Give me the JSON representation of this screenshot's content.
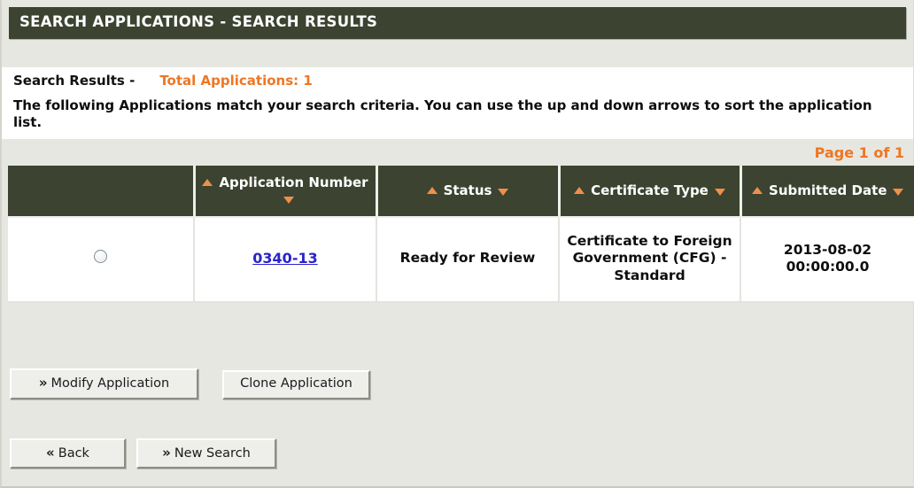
{
  "header": {
    "title": "SEARCH APPLICATIONS - SEARCH RESULTS"
  },
  "results": {
    "label": "Search Results -",
    "total_label": "Total Applications: 1",
    "description": "The following Applications match your search criteria. You can use the up and down arrows to sort the application list.",
    "page_indicator": "Page 1 of 1"
  },
  "table": {
    "columns": [
      {
        "label": "",
        "sortable": false
      },
      {
        "label": "Application Number",
        "sortable": true
      },
      {
        "label": "Status",
        "sortable": true
      },
      {
        "label": "Certificate Type",
        "sortable": true
      },
      {
        "label": "Submitted Date",
        "sortable": true
      }
    ],
    "rows": [
      {
        "selected": false,
        "application_number": "0340-13",
        "status": "Ready for Review",
        "certificate_type": "Certificate to Foreign Government (CFG) - Standard",
        "submitted_date_line1": "2013-08-02",
        "submitted_date_line2": "00:00:00.0"
      }
    ]
  },
  "buttons": {
    "modify_application": "Modify Application",
    "clone_application": "Clone Application",
    "back": "Back",
    "new_search": "New Search",
    "chevron_right": "»",
    "chevron_left": "«"
  },
  "colors": {
    "header_bar": "#3c4330",
    "accent_orange": "#ef7622",
    "sort_arrow": "#ef8f4a",
    "link_blue": "#2b23c9",
    "page_background": "#e7e7e2",
    "panel_white": "#ffffff"
  }
}
